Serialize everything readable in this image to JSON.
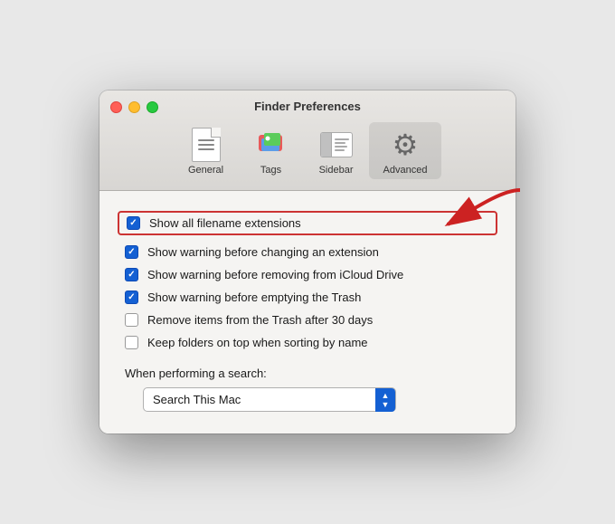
{
  "window": {
    "title": "Finder Preferences"
  },
  "tabs": [
    {
      "id": "general",
      "label": "General",
      "active": false
    },
    {
      "id": "tags",
      "label": "Tags",
      "active": false
    },
    {
      "id": "sidebar",
      "label": "Sidebar",
      "active": false
    },
    {
      "id": "advanced",
      "label": "Advanced",
      "active": true
    }
  ],
  "checkboxes": [
    {
      "id": "show-extensions",
      "label": "Show all filename extensions",
      "checked": true,
      "highlighted": true
    },
    {
      "id": "show-warning-extension",
      "label": "Show warning before changing an extension",
      "checked": true,
      "highlighted": false
    },
    {
      "id": "show-warning-icloud",
      "label": "Show warning before removing from iCloud Drive",
      "checked": true,
      "highlighted": false
    },
    {
      "id": "show-warning-trash",
      "label": "Show warning before emptying the Trash",
      "checked": true,
      "highlighted": false
    },
    {
      "id": "remove-trash",
      "label": "Remove items from the Trash after 30 days",
      "checked": false,
      "highlighted": false
    },
    {
      "id": "keep-folders",
      "label": "Keep folders on top when sorting by name",
      "checked": false,
      "highlighted": false
    }
  ],
  "search_section": {
    "label": "When performing a search:",
    "current_value": "Search This Mac"
  },
  "colors": {
    "checkbox_checked": "#1460d3",
    "highlight_border": "#cc3333",
    "select_arrow_bg": "#1460d3",
    "arrow_color": "#cc2222"
  }
}
